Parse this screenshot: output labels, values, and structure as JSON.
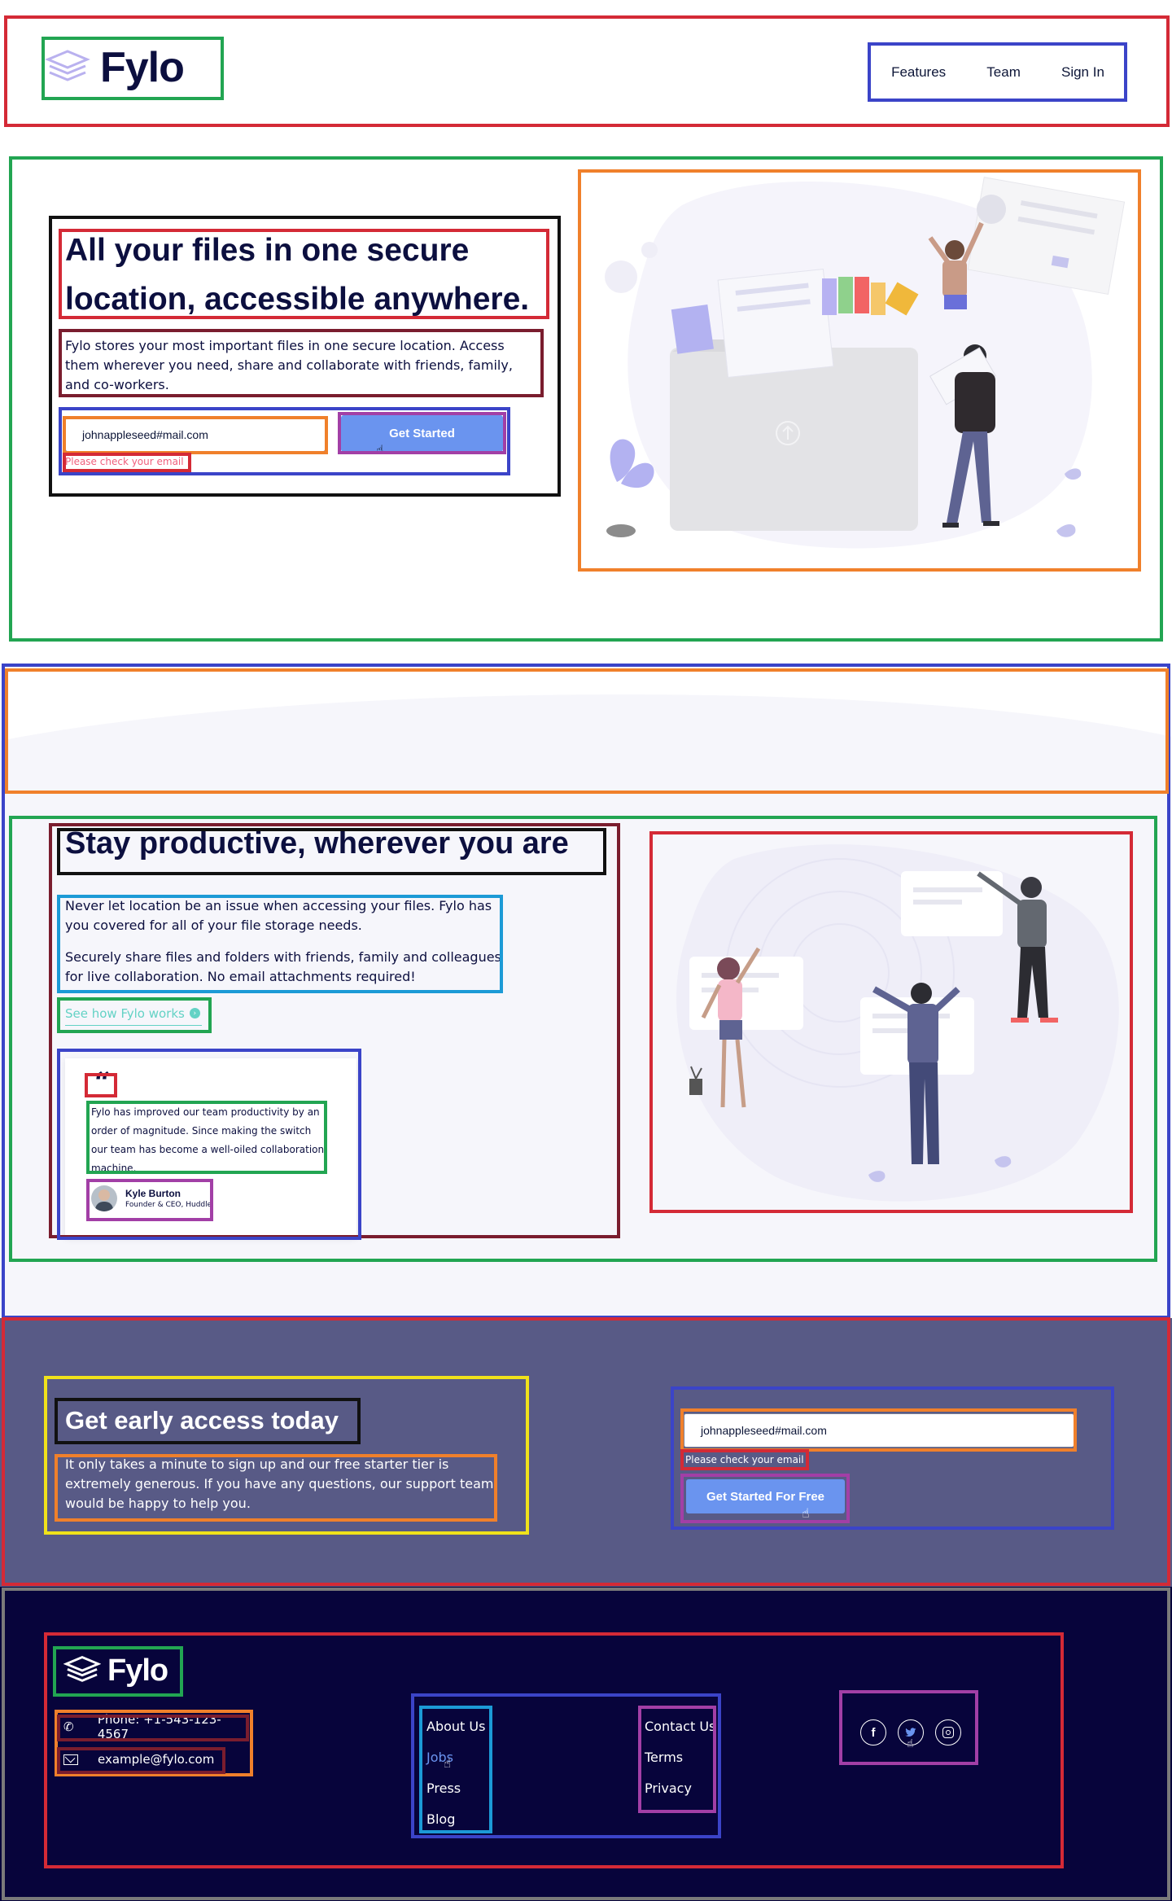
{
  "brand": {
    "name": "Fylo"
  },
  "nav": {
    "items": [
      "Features",
      "Team",
      "Sign In"
    ]
  },
  "hero": {
    "title_line1": "All your files in one secure",
    "title_line2": "location, accessible anywhere.",
    "description": "Fylo stores your most important files in one secure location. Access them wherever you need, share and collaborate with friends, family, and co-workers.",
    "email_value": "johnappleseed#mail.com",
    "button_label": "Get Started",
    "error_text": "Please check your email"
  },
  "productive": {
    "title": "Stay productive, wherever you are",
    "paragraph1": "Never let location be an issue when accessing your files. Fylo has you covered for all of your file storage needs.",
    "paragraph2": "Securely share files and folders with friends, family and colleagues for live collaboration. No email attachments required!",
    "link_label": "See how Fylo works",
    "quote_mark": "“",
    "testimonial": "Fylo has improved our team productivity by an order of magnitude. Since making the switch our team has become a well-oiled collaboration machine.",
    "author_name": "Kyle Burton",
    "author_title": "Founder & CEO, Huddle"
  },
  "early_access": {
    "title": "Get early access today",
    "description": "It only takes a minute to sign up and our free starter tier is extremely generous. If you have any questions, our support team would be happy to help you.",
    "email_value": "johnappleseed#mail.com",
    "error_text": "Please check your email",
    "button_label": "Get Started For Free"
  },
  "footer": {
    "phone": "Phone: +1-543-123-4567",
    "email": "example@fylo.com",
    "links_col1": [
      "About Us",
      "Jobs",
      "Press",
      "Blog"
    ],
    "links_col2": [
      "Contact Us",
      "Terms",
      "Privacy"
    ],
    "social_icons": [
      "facebook-icon",
      "twitter-icon",
      "instagram-icon"
    ]
  },
  "colors": {
    "dark_navy": "#0c0f3f",
    "accent_blue": "#6a94ef",
    "teal": "#63d2c5",
    "error_red": "#f0607d",
    "cta_bg": "#585a86",
    "footer_bg": "#07043b"
  }
}
